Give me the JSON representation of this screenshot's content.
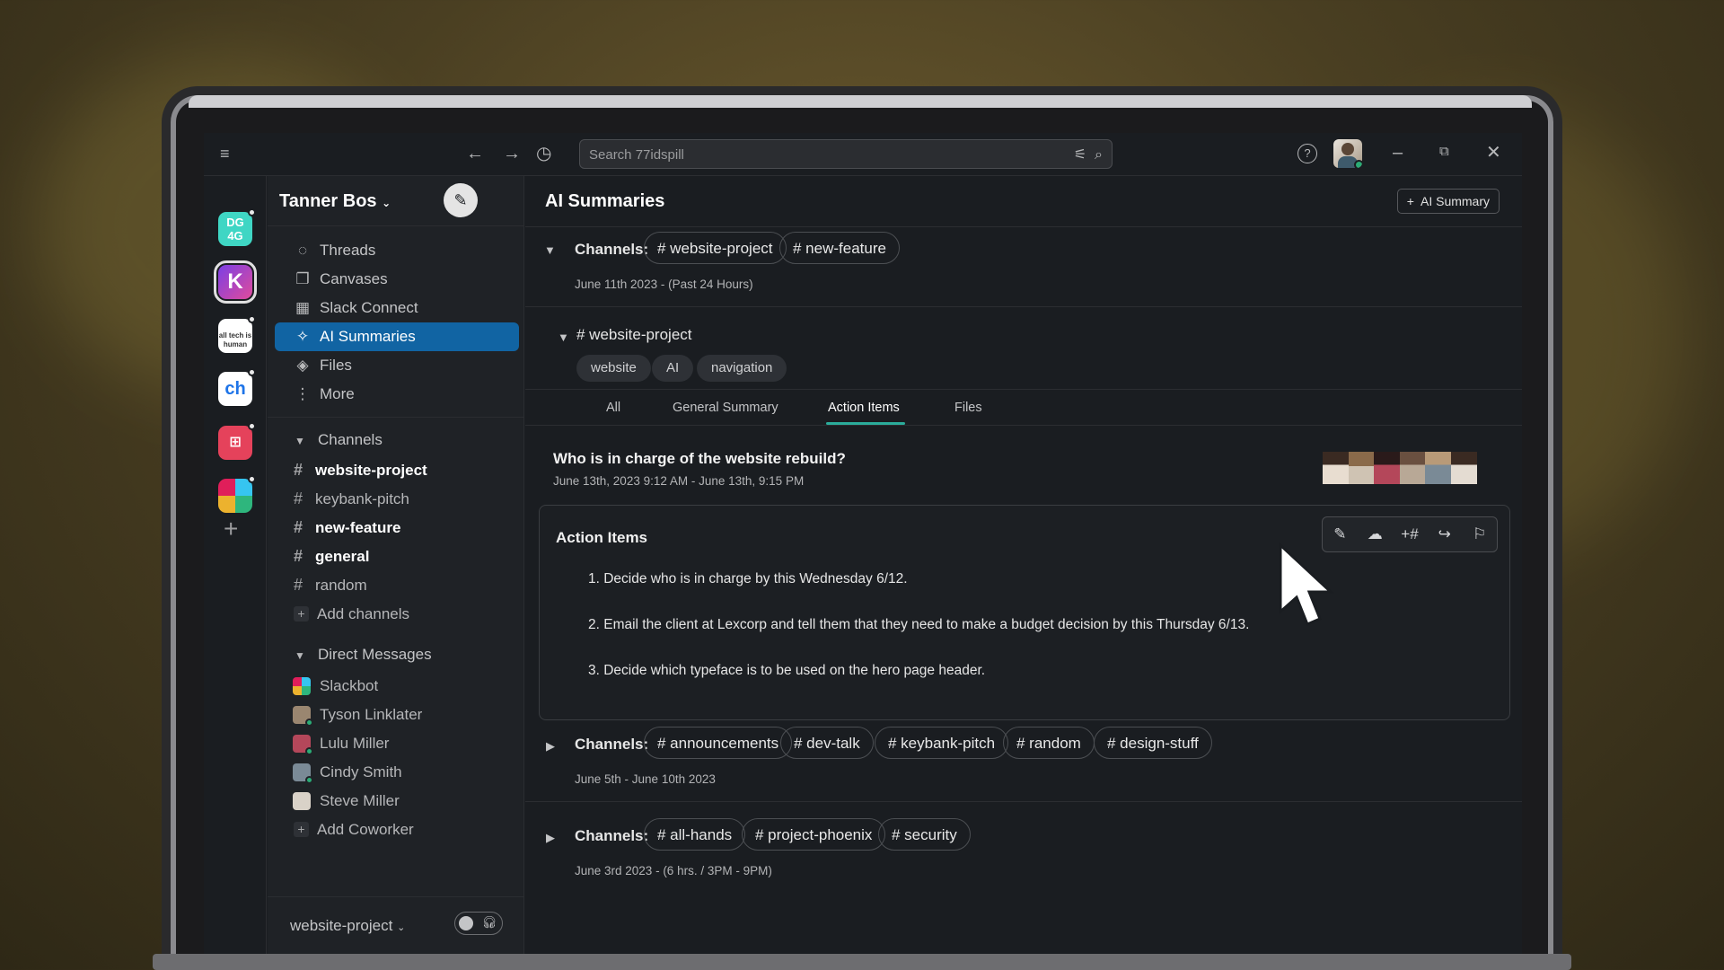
{
  "topbar": {
    "search_placeholder": "Search 77idspill"
  },
  "rail": {
    "workspaces": [
      {
        "name": "DG 4G",
        "bg": "#3fd6c4",
        "fg": "#ffffff"
      },
      {
        "name": "K",
        "bg": "#7b3fe4",
        "fg": "#ffffff"
      },
      {
        "name": "all tech is human",
        "bg": "#ffffff",
        "fg": "#333333"
      },
      {
        "name": "ch",
        "bg": "#ffffff",
        "fg": "#1e74e8"
      },
      {
        "name": "",
        "bg": "#e5425b",
        "fg": "#ffffff"
      },
      {
        "name": "",
        "bg": "#ffffff",
        "fg": "#e5425b"
      }
    ]
  },
  "sidebar": {
    "workspace_name": "Tanner Bos",
    "nav": [
      {
        "label": "Threads",
        "icon": "threads-icon"
      },
      {
        "label": "Canvases",
        "icon": "canvases-icon"
      },
      {
        "label": "Slack Connect",
        "icon": "building-icon"
      },
      {
        "label": "AI Summaries",
        "icon": "sparkle-icon"
      },
      {
        "label": "Files",
        "icon": "layers-icon"
      },
      {
        "label": "More",
        "icon": "more-vertical-icon"
      }
    ],
    "channels_label": "Channels",
    "channels": [
      {
        "name": "website-project",
        "bold": true
      },
      {
        "name": "keybank-pitch",
        "bold": false
      },
      {
        "name": "new-feature",
        "bold": true
      },
      {
        "name": "general",
        "bold": true
      },
      {
        "name": "random",
        "bold": false
      }
    ],
    "add_channels": "Add channels",
    "dm_label": "Direct Messages",
    "dms": [
      {
        "name": "Slackbot",
        "color": "#e01e5a"
      },
      {
        "name": "Tyson Linklater",
        "color": "#9a8670"
      },
      {
        "name": "Lulu Miller",
        "color": "#b4475a"
      },
      {
        "name": "Cindy Smith",
        "color": "#7a8a96"
      },
      {
        "name": "Steve Miller",
        "color": "#d9d2c8"
      }
    ],
    "add_coworker": "Add Coworker",
    "footer_channel": "website-project"
  },
  "main": {
    "title": "AI Summaries",
    "ai_summary_button": "AI Summary",
    "groups": [
      {
        "label": "Channels:",
        "channels": [
          "# website-project",
          "# new-feature"
        ],
        "date": "June 11th 2023 - (Past 24 Hours)"
      },
      {
        "label": "Channels:",
        "channels": [
          "# announcements",
          "# dev-talk",
          "# keybank-pitch",
          "# random",
          "# design-stuff"
        ],
        "date": "June 5th - June 10th 2023"
      },
      {
        "label": "Channels:",
        "channels": [
          "# all-hands",
          "# project-phoenix",
          "# security"
        ],
        "date": "June 3rd 2023 - (6 hrs. / 3PM - 9PM)"
      }
    ],
    "channel_title": "# website-project",
    "tags": [
      "website",
      "AI",
      "navigation"
    ],
    "tabs": [
      "All",
      "General Summary",
      "Action Items",
      "Files"
    ],
    "active_tab": "Action Items",
    "question": "Who is in charge of the website rebuild?",
    "question_date": "June 13th, 2023 9:12 AM - June 13th, 9:15 PM",
    "card_title": "Action Items",
    "action_items": [
      "1.  Decide who is in charge by this Wednesday 6/12.",
      "2.  Email the client at Lexcorp and tell them that they need to make a budget decision by this Thursday 6/13.",
      "3.  Decide which typeface is to be used on the hero page header."
    ],
    "tools": [
      "edit-icon",
      "cloud-download-icon",
      "add-channel-icon",
      "share-icon",
      "bookmark-icon"
    ]
  }
}
